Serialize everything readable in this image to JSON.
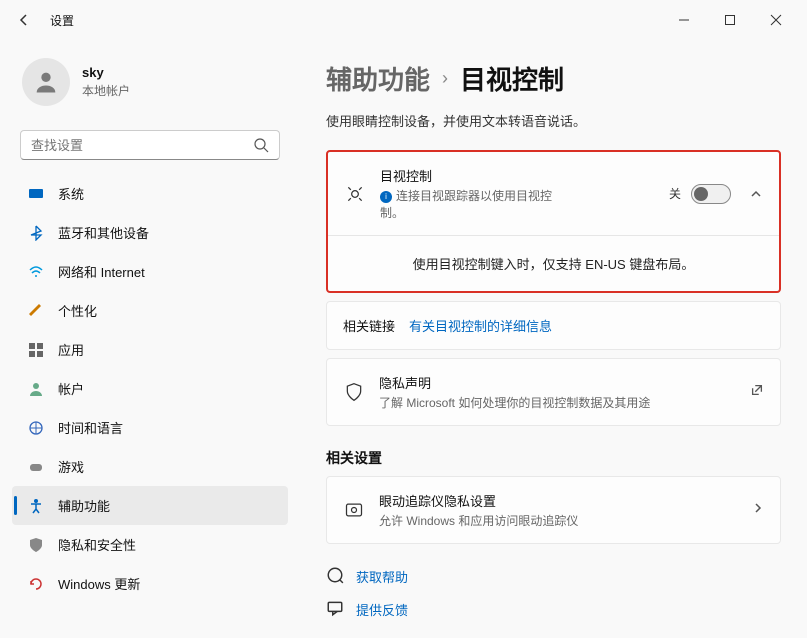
{
  "window": {
    "title": "设置"
  },
  "user": {
    "name": "sky",
    "account_type": "本地帐户"
  },
  "search": {
    "placeholder": "查找设置"
  },
  "nav": {
    "items": [
      {
        "id": "system",
        "label": "系统"
      },
      {
        "id": "bluetooth",
        "label": "蓝牙和其他设备"
      },
      {
        "id": "network",
        "label": "网络和 Internet"
      },
      {
        "id": "personalization",
        "label": "个性化"
      },
      {
        "id": "apps",
        "label": "应用"
      },
      {
        "id": "accounts",
        "label": "帐户"
      },
      {
        "id": "time-language",
        "label": "时间和语言"
      },
      {
        "id": "gaming",
        "label": "游戏"
      },
      {
        "id": "accessibility",
        "label": "辅助功能"
      },
      {
        "id": "privacy",
        "label": "隐私和安全性"
      },
      {
        "id": "windows-update",
        "label": "Windows 更新"
      }
    ]
  },
  "breadcrumb": {
    "parent": "辅助功能",
    "current": "目视控制"
  },
  "page": {
    "description": "使用眼睛控制设备，并使用文本转语音说话。"
  },
  "main_card": {
    "title": "目视控制",
    "subtitle": "连接目视跟踪器以使用目视控制。",
    "toggle_state_label": "关",
    "note": "使用目视控制键入时，仅支持 EN-US 键盘布局。"
  },
  "related_links": {
    "label": "相关链接",
    "link_text": "有关目视控制的详细信息"
  },
  "privacy_card": {
    "title": "隐私声明",
    "subtitle": "了解 Microsoft 如何处理你的目视控制数据及其用途"
  },
  "related_settings": {
    "heading": "相关设置",
    "eye_tracker": {
      "title": "眼动追踪仪隐私设置",
      "subtitle": "允许 Windows 和应用访问眼动追踪仪"
    }
  },
  "footer": {
    "get_help": "获取帮助",
    "give_feedback": "提供反馈"
  }
}
